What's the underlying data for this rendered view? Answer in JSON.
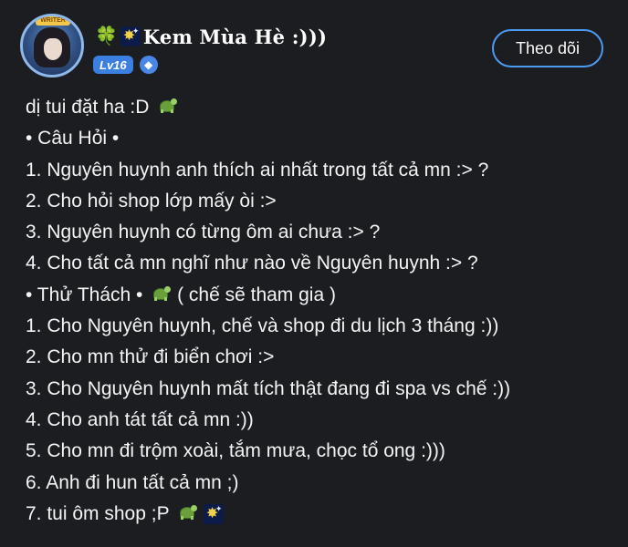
{
  "post": {
    "author_name": "Kem Mùa Hè :)))",
    "level_badge": "Lv16",
    "follow_label": "Theo dõi",
    "avatar_frame_label": "WRITER"
  },
  "content": {
    "lines": [
      "dị tui đặt ha :D",
      "• Câu Hỏi •",
      "1. Nguyên huynh anh thích ai nhất trong tất cả mn :> ?",
      "2. Cho hỏi shop lớp mấy òi :>",
      "3. Nguyên huynh có từng ôm ai chưa :> ?",
      "4. Cho tất cả mn nghĩ như nào về Nguyên huynh :> ?",
      "• Thử Thách •",
      "( chế sẽ tham gia )",
      "1. Cho Nguyên huynh, chế và shop đi du lịch 3 tháng :))",
      "2. Cho mn thử đi biển chơi :>",
      "3. Cho Nguyên huynh mất tích thật đang đi spa vs chế :))",
      "4. Cho anh tát tất cả mn :))",
      "5. Cho mn đi trộm xoài, tắm mưa, chọc tổ ong :)))",
      "6. Anh đi hun tất cả mn ;)",
      "7. tui ôm shop ;P"
    ]
  },
  "icons": {
    "name_prefix": [
      "four-leaf-clover-icon",
      "fireworks-icon"
    ],
    "turtle": "turtle-icon",
    "rank": "rank-icon"
  },
  "colors": {
    "background": "#1c1d21",
    "accent": "#4c9bf0",
    "level_badge": "#3b7fe0"
  }
}
